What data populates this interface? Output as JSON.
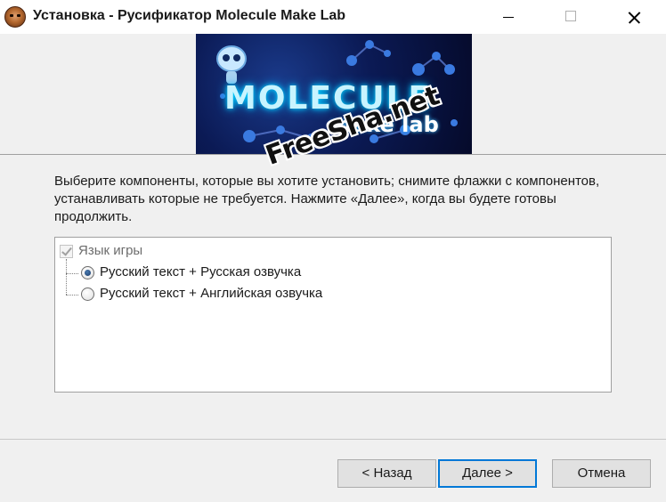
{
  "window": {
    "title": "Установка - Русификатор Molecule Make Lab",
    "icon": "app-face-icon",
    "buttons": {
      "minimize": "minimize-icon",
      "maximize": "maximize-icon",
      "close": "close-icon"
    }
  },
  "banner": {
    "logo_main": "MOLECULE",
    "logo_sub": "make lab",
    "colors": {
      "background": "#0b1a55",
      "glow": "#00d8ff"
    }
  },
  "instructions": "Выберите компоненты, которые вы хотите установить; снимите флажки с компонентов, устанавливать которые не требуется. Нажмите «Далее», когда вы будете готовы продолжить.",
  "components": {
    "group": {
      "label": "Язык игры",
      "checked": true,
      "disabled": true
    },
    "options": [
      {
        "label": "Русский текст + Русская озвучка",
        "selected": true
      },
      {
        "label": "Русский текст + Английская озвучка",
        "selected": false
      }
    ]
  },
  "buttons": {
    "back": "< Назад",
    "next": "Далее >",
    "cancel": "Отмена"
  },
  "watermark": "FreeSha.net",
  "colors": {
    "accent": "#0078d7",
    "window_bg": "#f0f0f0"
  }
}
